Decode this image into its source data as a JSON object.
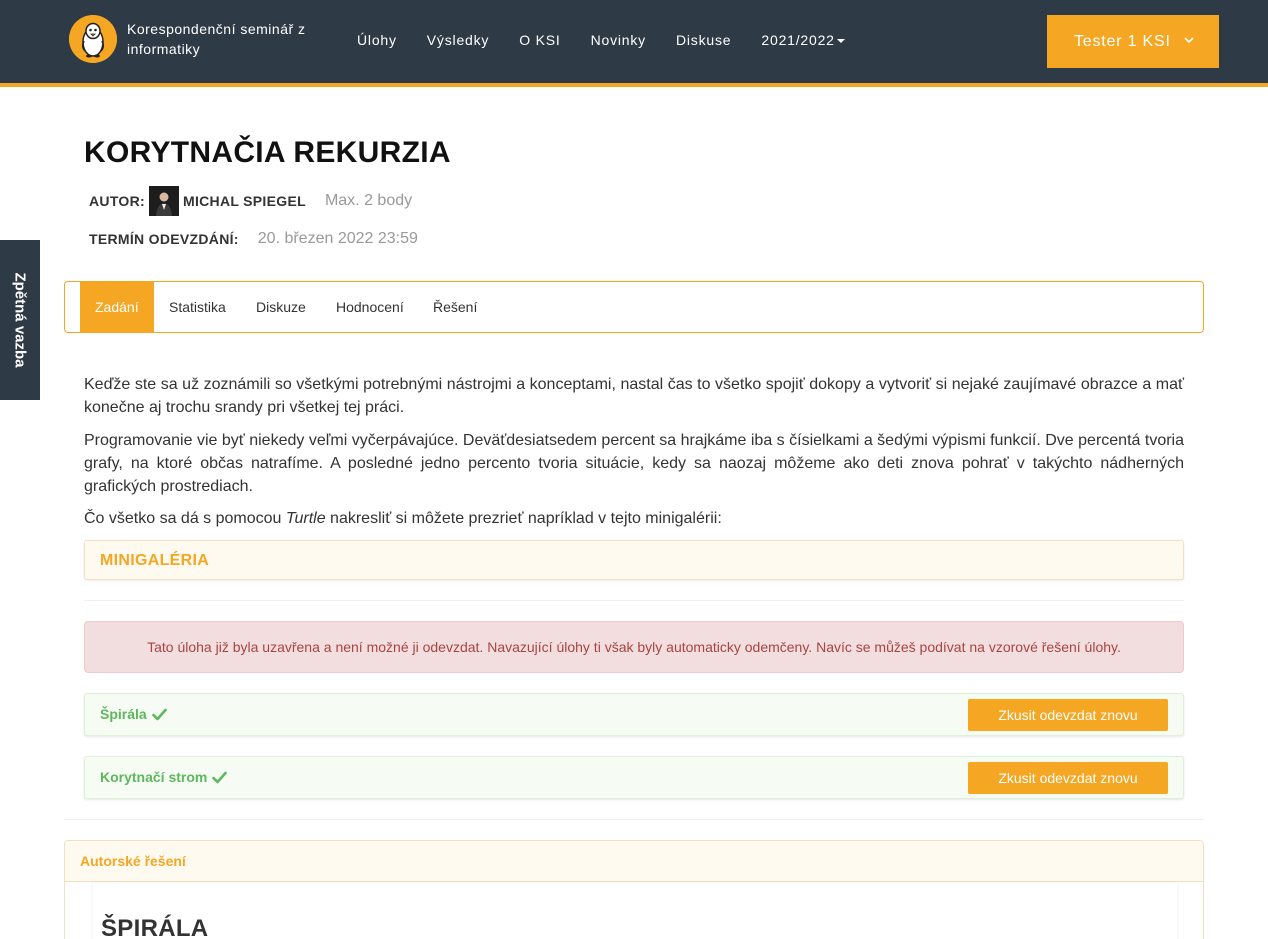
{
  "navbar": {
    "brand": "Korespondenční seminář z informatiky",
    "links": [
      "Úlohy",
      "Výsledky",
      "O KSI",
      "Novinky",
      "Diskuse"
    ],
    "year_dropdown": "2021/2022",
    "user_menu": "Tester 1 KSI"
  },
  "feedback_tab": "Zpětná vazba",
  "task": {
    "title": "KORYTNAČIA REKURZIA",
    "author_label": "AUTOR:",
    "author_name": "MICHAL SPIEGEL",
    "max_points": "Max. 2 body",
    "deadline_label": "TERMÍN ODEVZDÁNÍ:",
    "deadline_value": "20. březen 2022 23:59"
  },
  "tabs": [
    {
      "label": "Zadání",
      "active": true
    },
    {
      "label": "Statistika",
      "active": false
    },
    {
      "label": "Diskuze",
      "active": false
    },
    {
      "label": "Hodnocení",
      "active": false
    },
    {
      "label": "Řešení",
      "active": false
    }
  ],
  "content": {
    "paragraph1": "Keďže ste sa už zoznámili so všetkými potrebnými nástrojmi a konceptami, nastal čas to všetko spojiť dokopy a vytvoriť si nejaké zaujímavé obrazce a mať konečne aj trochu srandy pri všetkej tej práci.",
    "paragraph2": "Programovanie vie byť niekedy veľmi vyčerpávajúce. Deväťdesiatsedem percent sa hrajkáme iba s čísielkami a šedými výpismi funkcií. Dve percentá tvoria grafy, na ktoré občas natrafíme. A posledné jedno percento tvoria situácie, kedy sa naozaj môžeme ako deti znova pohrať v takýchto nádherných grafických prostrediach.",
    "paragraph3_before": "Čo všetko sa dá s pomocou ",
    "paragraph3_italic": "Turtle",
    "paragraph3_after": " nakresliť si môžete prezrieť napríklad v tejto minigalérii:",
    "gallery_title": "MINIGALÉRIA"
  },
  "alert": "Tato úloha již byla uzavřena a není možné ji odevzdat. Navazující úlohy ti však byly automaticky odemčeny. Navíc se můžeš podívat na vzorové řešení úlohy.",
  "modules": [
    {
      "name": "Špirála",
      "completed": true,
      "button": "Zkusit odevzdat znovu"
    },
    {
      "name": "Korytnačí strom",
      "completed": true,
      "button": "Zkusit odevzdat znovu"
    }
  ],
  "solution": {
    "panel_title": "Autorské řešení",
    "section_title": "ŠPIRÁLA"
  },
  "colors": {
    "navbar": "#2f3a47",
    "accent": "#f5a623",
    "success": "#5cb85c",
    "alert_text": "#a94442",
    "alert_bg": "#f2dede"
  }
}
